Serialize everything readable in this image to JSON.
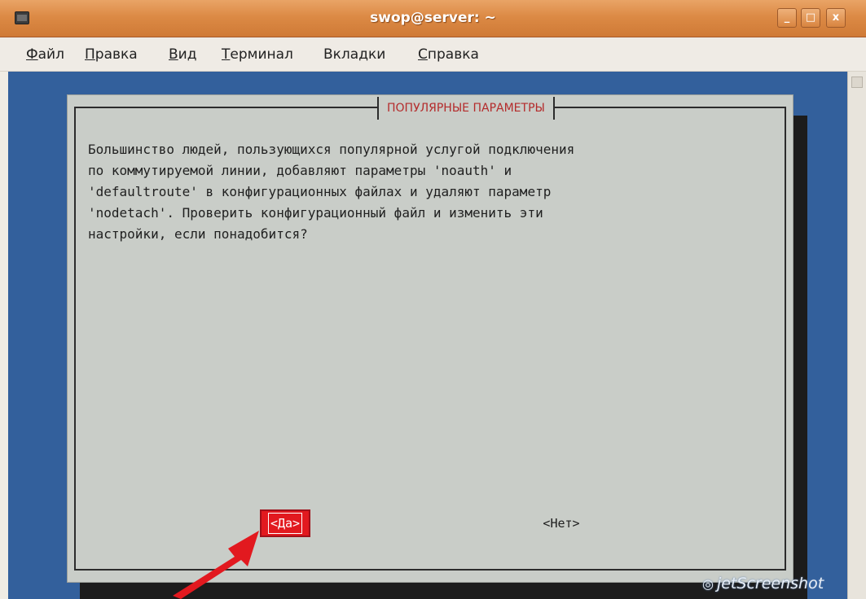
{
  "window": {
    "title": "swop@server: ~",
    "minimize_glyph": "_",
    "maximize_glyph": "□",
    "close_glyph": "x"
  },
  "menu": {
    "items": [
      {
        "first": "Ф",
        "rest": "айл"
      },
      {
        "first": "П",
        "rest": "равка"
      },
      {
        "first": "В",
        "rest": "ид"
      },
      {
        "first": "Т",
        "rest": "ерминал"
      },
      {
        "first": "",
        "rest": "Вкладки"
      },
      {
        "first": "С",
        "rest": "правка"
      }
    ]
  },
  "dialog": {
    "title": "ПОПУЛЯРНЫЕ ПАРАМЕТРЫ",
    "body": "Большинство людей, пользующихся популярной услугой подключения\nпо коммутируемой линии, добавляют параметры 'noauth' и\n'defaultroute' в конфигурационных файлах и удаляют параметр\n'nodetach'. Проверить конфигурационный файл и изменить эти\nнастройки, если понадобится?",
    "yes_label": "<Да>",
    "no_label": "<Нет>"
  },
  "watermark": {
    "text": "jetScreenshot",
    "icon": "camera-icon"
  },
  "colors": {
    "terminal_bg": "#33609c",
    "dialog_bg": "#c9cdc8",
    "dialog_title": "#b42b2b",
    "yes_button": "#e2191f",
    "arrow": "#e2191f"
  }
}
